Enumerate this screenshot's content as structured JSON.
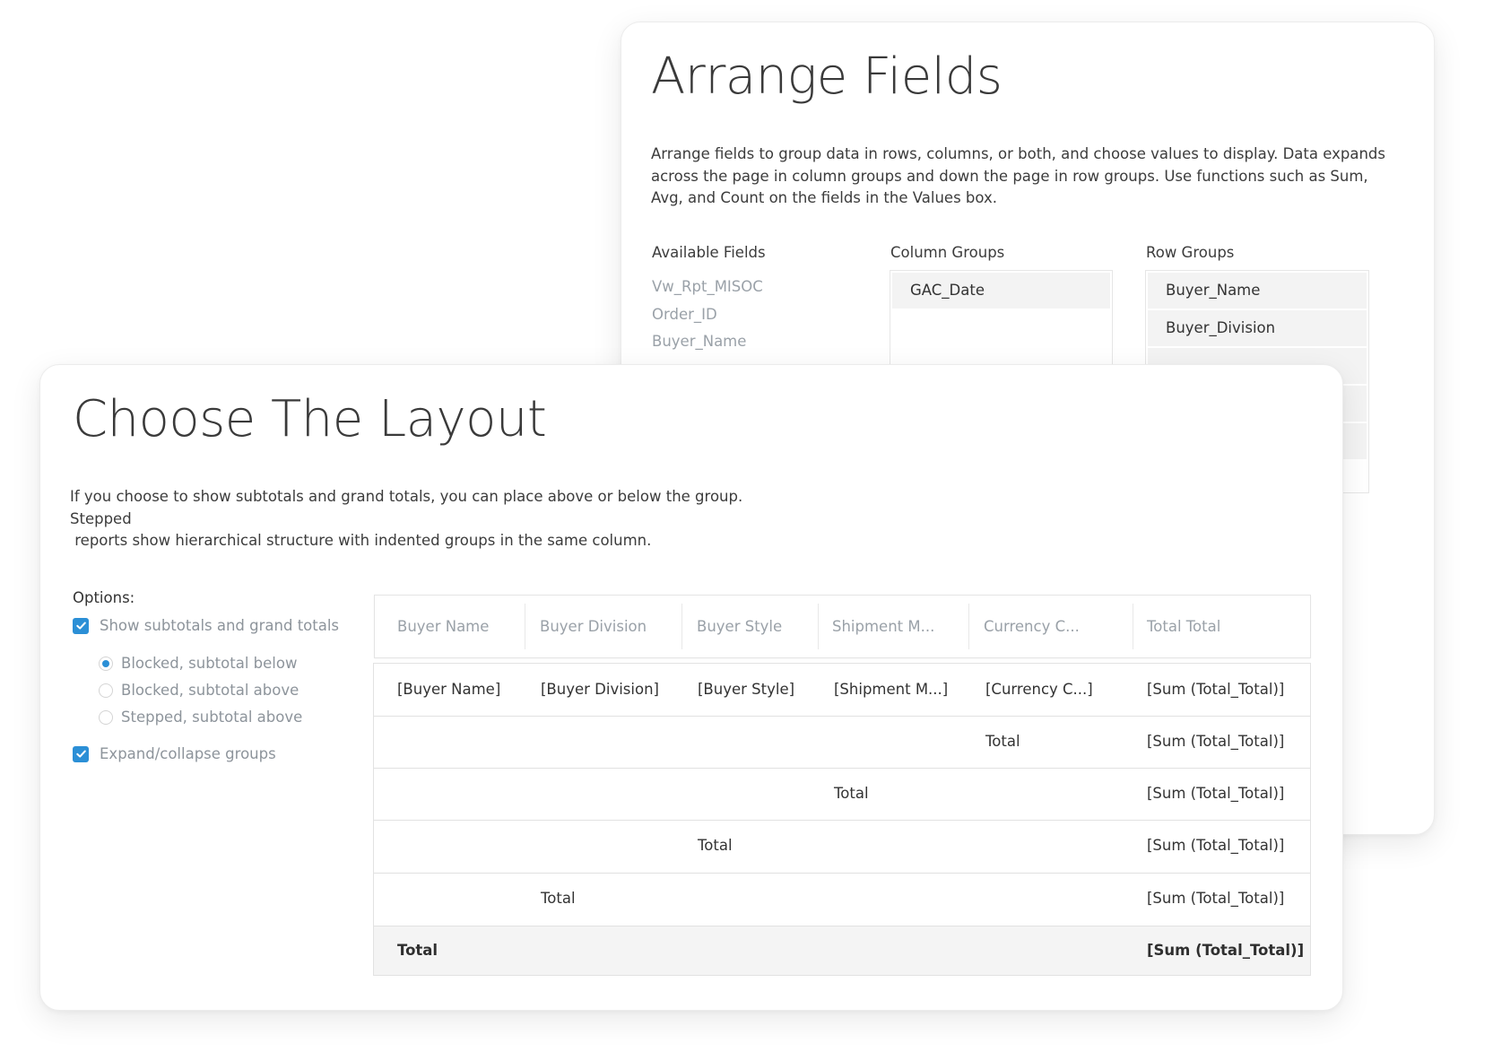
{
  "arrange": {
    "title": "Arrange Fields",
    "description": "Arrange fields to group data in rows, columns, or both, and choose values to display. Data expands across the page in column groups and down the page in row groups. Use functions such as Sum, Avg, and Count on the fields in the Values box.",
    "available_fields_label": "Available Fields",
    "available_fields": [
      "Vw_Rpt_MISOC",
      "Order_ID",
      "Buyer_Name"
    ],
    "column_groups_label": "Column Groups",
    "column_groups": [
      "GAC_Date"
    ],
    "row_groups_label": "Row Groups",
    "row_groups": [
      "Buyer_Name",
      "Buyer_Division"
    ]
  },
  "layout": {
    "title": "Choose The Layout",
    "description_line1": "If you choose to show subtotals and grand totals, you can place above or below the group. Stepped",
    "description_line2": " reports show hierarchical structure with indented groups in the same column.",
    "options_label": "Options:",
    "show_totals_label": "Show subtotals and grand totals",
    "show_totals_checked": true,
    "radio_options": [
      "Blocked, subtotal below",
      "Blocked, subtotal above",
      "Stepped, subtotal above"
    ],
    "selected_radio": "Blocked, subtotal below",
    "expand_collapse_label": "Expand/collapse groups",
    "expand_collapse_checked": true
  },
  "table": {
    "headers": [
      "Buyer Name",
      "Buyer Division",
      "Buyer Style",
      "Shipment M...",
      "Currency C...",
      "Total Total"
    ],
    "detail_row": [
      "[Buyer Name]",
      "[Buyer Division]",
      "[Buyer Style]",
      "[Shipment M...]",
      "[Currency C...]",
      "[Sum (Total_Total)]"
    ],
    "total_label": "Total",
    "sum_value": "[Sum (Total_Total)]"
  },
  "colors": {
    "accent": "#2b8fd6",
    "muted_text": "#9aa1a8",
    "grand_total_bg": "#f4f4f4"
  }
}
